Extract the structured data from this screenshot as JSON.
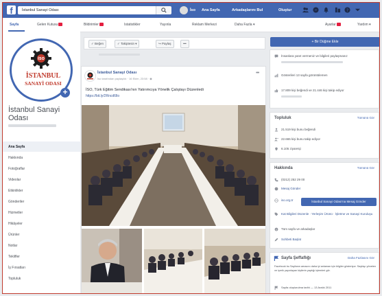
{
  "topbar": {
    "search_value": "İstanbul Sanayi Odası",
    "user_name": "İso",
    "links": [
      "Ana Sayfa",
      "Arkadaşlarını Bul",
      "Oluştur"
    ]
  },
  "page_nav": {
    "items": [
      "Sayfa",
      "Gelen Kutusu",
      "Bildirimler",
      "Istatistikler",
      "Yayınla",
      "Reklam Merkezi",
      "Daha Fazla ▾",
      "Ayarlar",
      "Yardım ▾"
    ]
  },
  "left": {
    "logo_line1": "İSTANBUL",
    "logo_line2": "SANAYİ ODASI",
    "page_name": "İstanbul Sanayi Odası",
    "nav": [
      "Ana Sayfa",
      "Hakkında",
      "Fotoğraflar",
      "Videolar",
      "Etkinlikler",
      "Gönderiler",
      "Hizmetler",
      "Hikâyeler",
      "Ürünler",
      "Notlar",
      "Teklifler",
      "İş Fırsatları",
      "Topluluk"
    ]
  },
  "toolbar": {
    "buttons": [
      "✓ Beğen",
      "✓ Takiptesin ▾",
      "↪ Paylaş",
      "•••"
    ]
  },
  "post": {
    "author": "İstanbul Sanayi Odası",
    "meta": "İso tarafından paylaşıldı · 16 Ekim, 23:58 · ◉",
    "text": "İSO, Türk Eğitim Sendikası'nın Yatırımcıya Yönelik Çalıştayı Düzenledi",
    "link": "https://bit.ly/2Rncd6lIo"
  },
  "right": {
    "cta_label": "+ Bir Düğme Ekle",
    "top_rows": [
      "İnsanlara yanıt vermeniz ve bilgileri paylaşmanız",
      "Gösterileri 13 sayfa görüntülemen",
      "17.809 kişi beğendi ve 21.446 kişi takip ediyor"
    ],
    "community": {
      "title": "Topluluk",
      "link": "Tümünü Gör",
      "rows": [
        "21.519 kişi bunu beğendi",
        "22.665 kişi bunu takip ediyor",
        "6.105 ziyaretçi"
      ]
    },
    "about": {
      "title": "Hakkında",
      "link": "Tümünü Gör",
      "rows": [
        "(0212) 252 29 00",
        "Mesaj Gönder",
        "iso.org.tr",
        "Kat Bilgileri Düzenle · Yerleşim Ürünü · İşletme ve Sanayi Kuruluşu",
        "Tüm sayfa ve arkadaşlar",
        "Sohbeti Başlat"
      ],
      "send_button": "İstanbul Sanayi Odası'na Mesaj Gönder"
    },
    "transparency": {
      "title": "Sayfa Şeffaflığı",
      "link": "Daha Fazlasını Gör",
      "desc": "Facebook bu Sayfanın amacını daha iyi anlaman için bilgiler gösteriyor. Sayfayı yöneten ve içerik yayınlayan kişilerin yaptığı işlemleri gör.",
      "footer": "Sayfa oluşturulma tarihi — 13 Aralık 2011"
    }
  }
}
